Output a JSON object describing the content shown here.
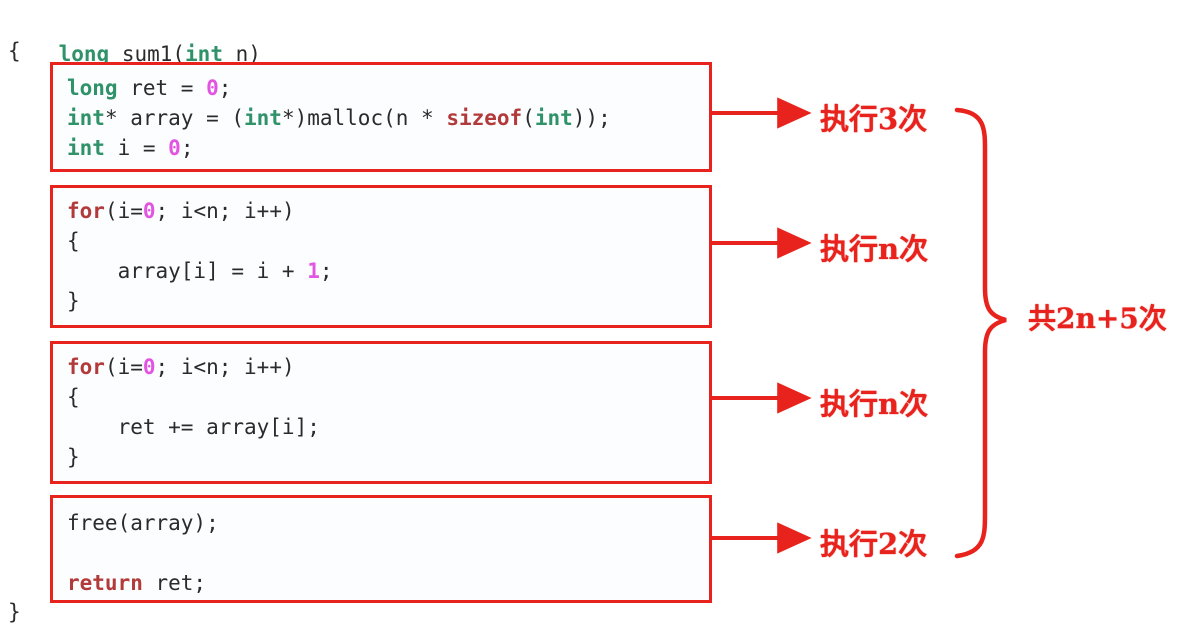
{
  "figure": {
    "title": "sum1 time-complexity annotation diagram",
    "accent_color": "#e8221c",
    "type_keyword_color": "#2f9268",
    "control_keyword_color": "#b33a3a",
    "number_literal_color": "#e254e2",
    "code_text_color": "#2b2b2b",
    "box_background": "#fbfdff"
  },
  "code": {
    "signature": {
      "kw_long": "long",
      "space1": " ",
      "fn_name": "sum1(",
      "kw_int": "int",
      "params": " n)"
    },
    "open_brace": "{",
    "close_brace": "}",
    "blocks": [
      {
        "id": "block-declarations",
        "lines": [
          {
            "tokens": [
              {
                "t": "long",
                "c": "kw-type"
              },
              {
                "t": " ret = ",
                "c": "plain"
              },
              {
                "t": "0",
                "c": "num"
              },
              {
                "t": ";",
                "c": "plain"
              }
            ]
          },
          {
            "tokens": [
              {
                "t": "int",
                "c": "kw-type"
              },
              {
                "t": "* array = (",
                "c": "plain"
              },
              {
                "t": "int",
                "c": "kw-type"
              },
              {
                "t": "*)malloc(n * ",
                "c": "plain"
              },
              {
                "t": "sizeof",
                "c": "kw-ctrl"
              },
              {
                "t": "(",
                "c": "plain"
              },
              {
                "t": "int",
                "c": "kw-type"
              },
              {
                "t": "));",
                "c": "plain"
              }
            ]
          },
          {
            "tokens": [
              {
                "t": "int",
                "c": "kw-type"
              },
              {
                "t": " i = ",
                "c": "plain"
              },
              {
                "t": "0",
                "c": "num"
              },
              {
                "t": ";",
                "c": "plain"
              }
            ]
          }
        ]
      },
      {
        "id": "block-fill-loop",
        "lines": [
          {
            "tokens": [
              {
                "t": "for",
                "c": "kw-ctrl"
              },
              {
                "t": "(i=",
                "c": "plain"
              },
              {
                "t": "0",
                "c": "num"
              },
              {
                "t": "; i<n; i++)",
                "c": "plain"
              }
            ]
          },
          {
            "tokens": [
              {
                "t": "{",
                "c": "plain"
              }
            ]
          },
          {
            "tokens": [
              {
                "t": "    array[i] = i + ",
                "c": "plain"
              },
              {
                "t": "1",
                "c": "num"
              },
              {
                "t": ";",
                "c": "plain"
              }
            ]
          },
          {
            "tokens": [
              {
                "t": "}",
                "c": "plain"
              }
            ]
          }
        ]
      },
      {
        "id": "block-sum-loop",
        "lines": [
          {
            "tokens": [
              {
                "t": "for",
                "c": "kw-ctrl"
              },
              {
                "t": "(i=",
                "c": "plain"
              },
              {
                "t": "0",
                "c": "num"
              },
              {
                "t": "; i<n; i++)",
                "c": "plain"
              }
            ]
          },
          {
            "tokens": [
              {
                "t": "{",
                "c": "plain"
              }
            ]
          },
          {
            "tokens": [
              {
                "t": "    ret += array[i];",
                "c": "plain"
              }
            ]
          },
          {
            "tokens": [
              {
                "t": "}",
                "c": "plain"
              }
            ]
          }
        ]
      },
      {
        "id": "block-cleanup",
        "lines": [
          {
            "tokens": [
              {
                "t": "free(array);",
                "c": "plain"
              }
            ]
          },
          {
            "tokens": [
              {
                "t": " ",
                "c": "plain"
              }
            ]
          },
          {
            "tokens": [
              {
                "t": "return",
                "c": "kw-ctrl"
              },
              {
                "t": " ret;",
                "c": "plain"
              }
            ]
          }
        ]
      }
    ]
  },
  "annotations": {
    "block1": "执行3次",
    "block2": "执行n次",
    "block3": "执行n次",
    "block4": "执行2次",
    "total": "共2n+5次"
  }
}
